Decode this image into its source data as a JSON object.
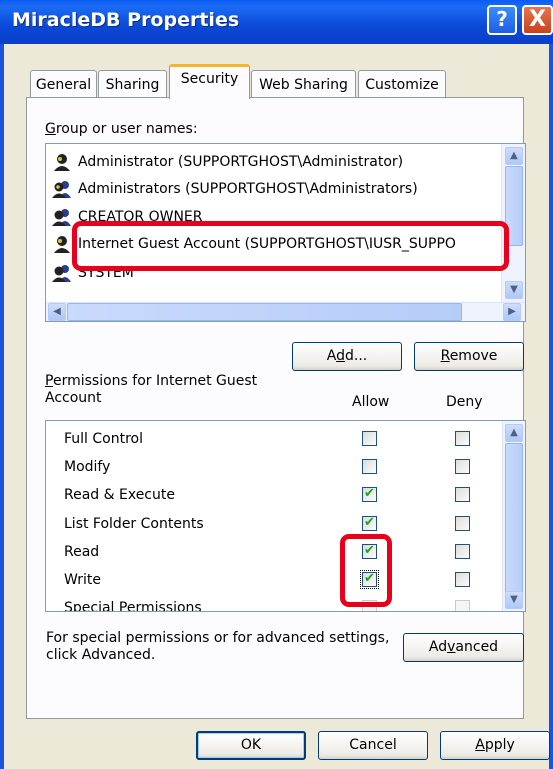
{
  "window": {
    "title": "MiracleDB Properties",
    "help_label": "?",
    "close_label": "X"
  },
  "tabs": [
    "General",
    "Sharing",
    "Security",
    "Web Sharing",
    "Customize"
  ],
  "group_label": {
    "first": "G",
    "rest": "roup or user names:"
  },
  "users": [
    "Administrator (SUPPORTGHOST\\Administrator)",
    "Administrators (SUPPORTGHOST\\Administrators)",
    "CREATOR OWNER",
    "Internet Guest Account (SUPPORTGHOST\\IUSR_SUPPO",
    "SYSTEM"
  ],
  "add_button": {
    "pre": "A",
    "ul": "d",
    "post": "d..."
  },
  "remove_button": {
    "ul": "R",
    "post": "emove"
  },
  "permissions_label": {
    "first": "P",
    "line1_rest": "ermissions for Internet Guest",
    "line2": "Account"
  },
  "allow_header": "Allow",
  "deny_header": "Deny",
  "permissions": [
    {
      "name": "Full Control",
      "allow": false,
      "deny": false
    },
    {
      "name": "Modify",
      "allow": false,
      "deny": false
    },
    {
      "name": "Read & Execute",
      "allow": true,
      "deny": false
    },
    {
      "name": "List Folder Contents",
      "allow": true,
      "deny": false
    },
    {
      "name": "Read",
      "allow": true,
      "deny": false
    },
    {
      "name": "Write",
      "allow": true,
      "deny": false
    },
    {
      "name": "Special Permissions",
      "allow": false,
      "deny": false
    }
  ],
  "advanced_note": {
    "line1": "For special permissions or for advanced settings,",
    "line2": "click Advanced."
  },
  "advanced_button": {
    "pre": "Ad",
    "ul": "v",
    "post": "anced"
  },
  "ok_label": "OK",
  "cancel_label": "Cancel",
  "apply_button": {
    "ul": "A",
    "post": "pply"
  },
  "colors": {
    "title_bar": "#0a5cf3",
    "highlight": "#e8001c",
    "check": "#21a121",
    "dialog_bg": "#ece9d8"
  }
}
